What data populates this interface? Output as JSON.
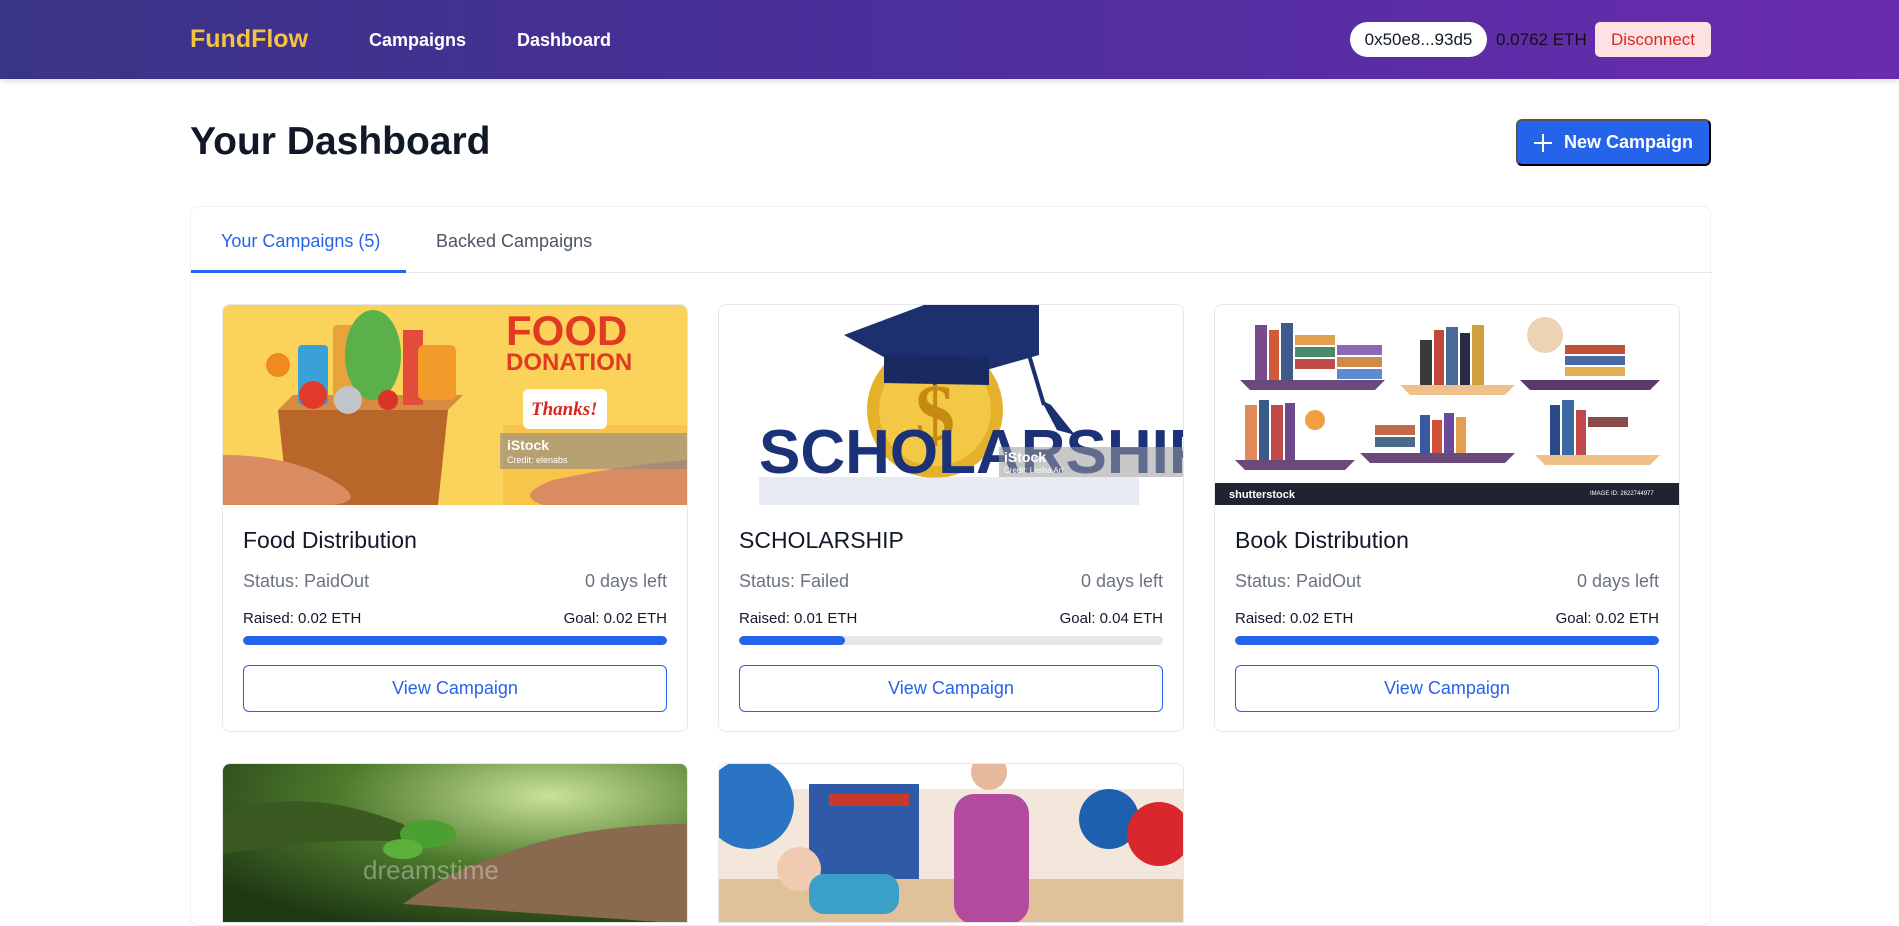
{
  "navbar": {
    "brand": "FundFlow",
    "links": [
      "Campaigns",
      "Dashboard"
    ],
    "wallet_address": "0x50e8...93d5",
    "balance": "0.0762 ETH",
    "disconnect_label": "Disconnect"
  },
  "header": {
    "title": "Your Dashboard",
    "new_campaign_label": "New Campaign"
  },
  "tabs": [
    {
      "label": "Your Campaigns (5)",
      "active": true
    },
    {
      "label": "Backed Campaigns",
      "active": false
    }
  ],
  "campaigns": [
    {
      "title": "Food Distribution",
      "status": "Status: PaidOut",
      "days_left": "0 days left",
      "raised": "Raised: 0.02 ETH",
      "goal": "Goal: 0.02 ETH",
      "progress": 1.0,
      "button": "View Campaign",
      "image_text": {
        "line1": "FOOD",
        "line2": "DONATION",
        "badge": "Thanks!",
        "watermark": "iStock",
        "credit": "Credit: elenabs"
      }
    },
    {
      "title": "SCHOLARSHIP",
      "status": "Status: Failed",
      "days_left": "0 days left",
      "raised": "Raised: 0.01 ETH",
      "goal": "Goal: 0.04 ETH",
      "progress": 0.25,
      "button": "View Campaign",
      "image_text": {
        "word": "SCHOLARSHIP",
        "symbol": "$",
        "watermark": "iStock",
        "credit": "Credit: Lesha Art"
      }
    },
    {
      "title": "Book Distribution",
      "status": "Status: PaidOut",
      "days_left": "0 days left",
      "raised": "Raised: 0.02 ETH",
      "goal": "Goal: 0.02 ETH",
      "progress": 1.0,
      "button": "View Campaign",
      "image_text": {
        "watermark": "shutterstock",
        "image_id": "IMAGE ID: 2622744977"
      }
    }
  ],
  "more_cards": [
    {
      "image_text": {
        "watermark": "dreamstime"
      }
    },
    {
      "image_text": {}
    }
  ],
  "colors": {
    "accent": "#2563eb",
    "brand": "#f5c242",
    "danger": "#dc2626"
  }
}
